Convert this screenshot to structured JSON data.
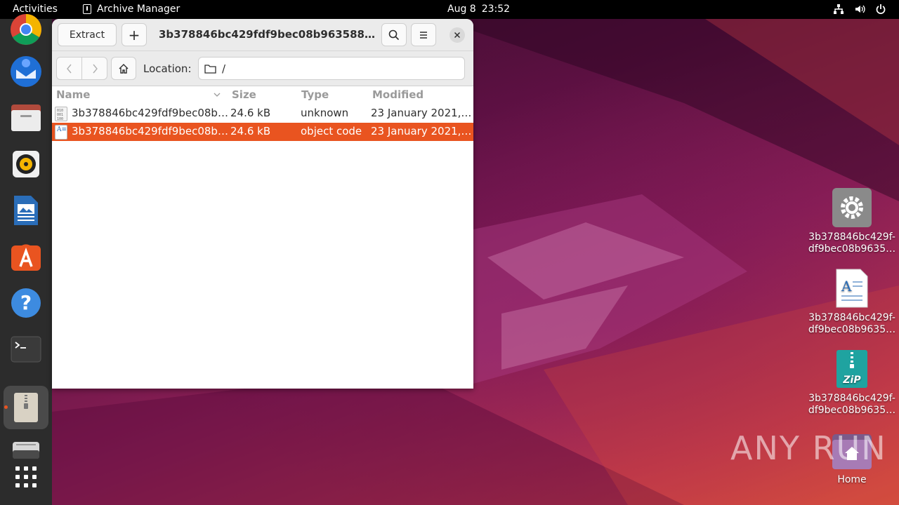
{
  "topbar": {
    "activities": "Activities",
    "app_name": "Archive Manager",
    "date": "Aug 8",
    "time": "23:52",
    "tray_icons": [
      "network-icon",
      "volume-icon",
      "power-icon"
    ]
  },
  "dock": {
    "items": [
      "chrome-icon",
      "thunderbird-icon",
      "files-icon",
      "rhythmbox-icon",
      "libreoffice-writer-icon",
      "app-center-icon",
      "help-icon",
      "terminal-icon",
      "archive-manager-icon",
      "disk-icon",
      "show-apps-icon"
    ]
  },
  "window": {
    "extract_label": "Extract",
    "add_label": "+",
    "title": "3b378846bc429fdf9bec08b963588…",
    "location_label": "Location:",
    "location_value": "/",
    "columns": [
      "Name",
      "Size",
      "Type",
      "Modified"
    ],
    "rows": [
      {
        "name": "3b378846bc429fdf9bec08b…",
        "size": "24.6 kB",
        "type": "unknown",
        "modified": "23 January 2021,…",
        "icon": "binary-file-icon"
      },
      {
        "name": "3b378846bc429fdf9bec08b…",
        "size": "24.6 kB",
        "type": "object code",
        "modified": "23 January 2021,…",
        "icon": "document-file-icon"
      }
    ]
  },
  "desktop": {
    "icons": [
      {
        "label1": "3b378846bc429f-",
        "label2": "df9bec08b9635…",
        "icon": "settings-gear-icon"
      },
      {
        "label1": "3b378846bc429f-",
        "label2": "df9bec08b9635…",
        "icon": "text-document-icon"
      },
      {
        "label1": "3b378846bc429f-",
        "label2": "df9bec08b9635…",
        "icon": "zip-archive-icon"
      },
      {
        "label1": "Home",
        "icon": "home-folder-icon"
      }
    ]
  },
  "watermark": "ANY RUN",
  "colors": {
    "accent": "#e95420",
    "dock": "#2c2c2c",
    "topbar": "#000000"
  }
}
